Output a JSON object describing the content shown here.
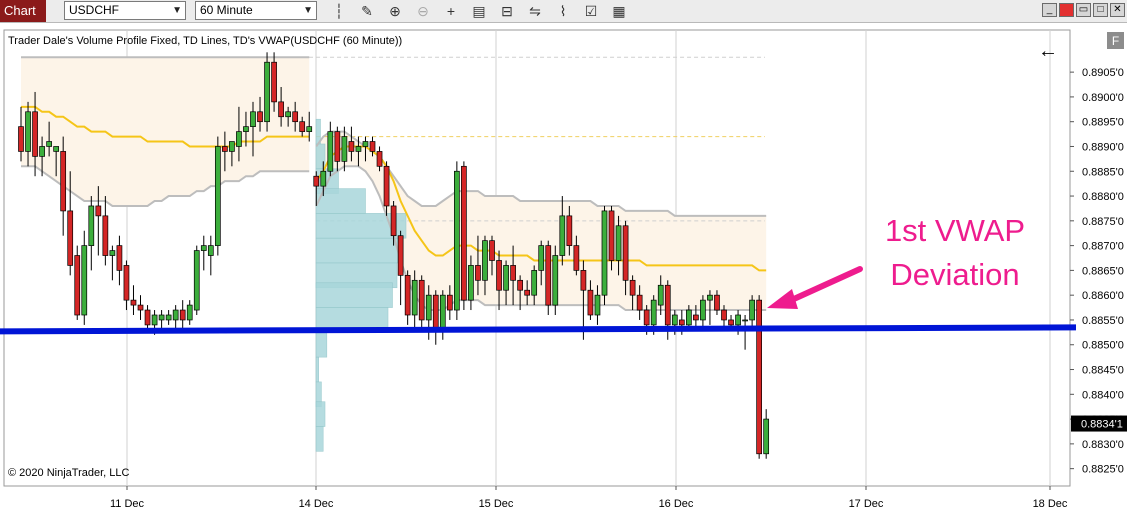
{
  "toolbar": {
    "tab_label": "Chart",
    "instrument": "USDCHF",
    "timeframe": "60 Minute",
    "icons": [
      "bar-style-icon",
      "draw-pencil-icon",
      "zoom-in-icon",
      "zoom-out-icon",
      "crosshair-icon",
      "data-box-icon",
      "indicators-icon",
      "strategies-icon",
      "properties-icon"
    ],
    "window_buttons": [
      "minimize",
      "restore",
      "maximize",
      "close"
    ]
  },
  "chart": {
    "title_text": "Trader Dale's Volume Profile Fixed, TD Lines, TD's VWAP(USDCHF (60 Minute))",
    "copyright": "© 2020 NinjaTrader, LLC",
    "panel_letter": "F",
    "back_arrow_glyph": "←",
    "last_price_label": "0.8834'1",
    "annotation_line1": "1st VWAP",
    "annotation_line2": "Deviation",
    "colors": {
      "up": "#3cae3c",
      "down": "#d42626",
      "vwap": "#f5c518",
      "band": "#bdbdbd",
      "support": "#0015d6",
      "profile": "#a9d7db",
      "arrow": "#ee1c8e"
    }
  },
  "chart_data": {
    "type": "candlestick",
    "x_axis_labels": [
      "11 Dec",
      "14 Dec",
      "15 Dec",
      "16 Dec",
      "17 Dec",
      "18 Dec"
    ],
    "y_axis_labels": [
      "0.8905'0",
      "0.8900'0",
      "0.8895'0",
      "0.8890'0",
      "0.8885'0",
      "0.8880'0",
      "0.8875'0",
      "0.8870'0",
      "0.8865'0",
      "0.8860'0",
      "0.8855'0",
      "0.8850'0",
      "0.8845'0",
      "0.8840'0",
      "0.8835'0",
      "0.8830'0",
      "0.8825'0"
    ],
    "y_ticks": [
      0.8905,
      0.89,
      0.8895,
      0.889,
      0.8885,
      0.888,
      0.8875,
      0.887,
      0.8865,
      0.886,
      0.8855,
      0.885,
      0.8845,
      0.884,
      0.8835,
      0.883,
      0.8825
    ],
    "ylim": [
      0.88215,
      0.89135
    ],
    "last_price": 0.88341,
    "support_level": 0.88531,
    "candles": [
      [
        0.8894,
        0.8898,
        0.8887,
        0.8889
      ],
      [
        0.8889,
        0.8899,
        0.8886,
        0.8897
      ],
      [
        0.8897,
        0.8901,
        0.8884,
        0.8888
      ],
      [
        0.8888,
        0.8892,
        0.8884,
        0.889
      ],
      [
        0.889,
        0.8895,
        0.8888,
        0.8891
      ],
      [
        0.8889,
        0.889,
        0.8884,
        0.889
      ],
      [
        0.8889,
        0.8892,
        0.8872,
        0.8877
      ],
      [
        0.8877,
        0.8885,
        0.8864,
        0.8866
      ],
      [
        0.8868,
        0.887,
        0.8855,
        0.8856
      ],
      [
        0.8856,
        0.8873,
        0.8854,
        0.887
      ],
      [
        0.887,
        0.888,
        0.8865,
        0.8878
      ],
      [
        0.8878,
        0.8882,
        0.8868,
        0.8876
      ],
      [
        0.8876,
        0.888,
        0.8866,
        0.8868
      ],
      [
        0.8868,
        0.887,
        0.8863,
        0.8869
      ],
      [
        0.887,
        0.8872,
        0.8862,
        0.8865
      ],
      [
        0.8866,
        0.8867,
        0.8857,
        0.8859
      ],
      [
        0.8859,
        0.8862,
        0.8856,
        0.8858
      ],
      [
        0.8858,
        0.886,
        0.8855,
        0.8857
      ],
      [
        0.8857,
        0.8858,
        0.8853,
        0.8854
      ],
      [
        0.8854,
        0.8857,
        0.8852,
        0.8856
      ],
      [
        0.8855,
        0.8857,
        0.8853,
        0.8856
      ],
      [
        0.8855,
        0.8857,
        0.8854,
        0.8856
      ],
      [
        0.8855,
        0.8858,
        0.8853,
        0.8857
      ],
      [
        0.8857,
        0.8859,
        0.8853,
        0.8855
      ],
      [
        0.8855,
        0.8859,
        0.8854,
        0.8858
      ],
      [
        0.8857,
        0.887,
        0.8856,
        0.8869
      ],
      [
        0.8869,
        0.8872,
        0.8865,
        0.887
      ],
      [
        0.8868,
        0.8872,
        0.8864,
        0.887
      ],
      [
        0.887,
        0.8892,
        0.8868,
        0.889
      ],
      [
        0.889,
        0.8893,
        0.8885,
        0.8889
      ],
      [
        0.8889,
        0.8891,
        0.8886,
        0.8891
      ],
      [
        0.889,
        0.8898,
        0.8887,
        0.8893
      ],
      [
        0.8893,
        0.8897,
        0.889,
        0.8894
      ],
      [
        0.8894,
        0.8899,
        0.8888,
        0.8897
      ],
      [
        0.8897,
        0.89,
        0.8893,
        0.8895
      ],
      [
        0.8895,
        0.8909,
        0.8893,
        0.8907
      ],
      [
        0.8907,
        0.8909,
        0.8897,
        0.8899
      ],
      [
        0.8899,
        0.8902,
        0.8894,
        0.8896
      ],
      [
        0.8896,
        0.8898,
        0.8894,
        0.8897
      ],
      [
        0.8897,
        0.8899,
        0.8893,
        0.8895
      ],
      [
        0.8895,
        0.8896,
        0.8892,
        0.8893
      ],
      [
        0.8893,
        0.8897,
        0.8891,
        0.8894
      ],
      [
        0.8884,
        0.8885,
        0.8878,
        0.8882
      ],
      [
        0.8882,
        0.8887,
        0.888,
        0.8885
      ],
      [
        0.8885,
        0.8895,
        0.8884,
        0.8893
      ],
      [
        0.8893,
        0.8894,
        0.8885,
        0.8887
      ],
      [
        0.8887,
        0.8894,
        0.8885,
        0.8892
      ],
      [
        0.8891,
        0.8894,
        0.8887,
        0.8889
      ],
      [
        0.8889,
        0.8892,
        0.8886,
        0.889
      ],
      [
        0.889,
        0.8892,
        0.8887,
        0.8891
      ],
      [
        0.8891,
        0.8892,
        0.8888,
        0.8889
      ],
      [
        0.8889,
        0.889,
        0.8885,
        0.8886
      ],
      [
        0.8886,
        0.8887,
        0.8876,
        0.8878
      ],
      [
        0.8878,
        0.8879,
        0.887,
        0.8872
      ],
      [
        0.8872,
        0.8873,
        0.8858,
        0.8864
      ],
      [
        0.8864,
        0.8865,
        0.8854,
        0.8856
      ],
      [
        0.8856,
        0.8865,
        0.8853,
        0.8863
      ],
      [
        0.8863,
        0.8864,
        0.8853,
        0.8855
      ],
      [
        0.8855,
        0.8862,
        0.8851,
        0.886
      ],
      [
        0.886,
        0.8861,
        0.885,
        0.8853
      ],
      [
        0.8853,
        0.8861,
        0.8851,
        0.886
      ],
      [
        0.886,
        0.8862,
        0.8855,
        0.8857
      ],
      [
        0.8857,
        0.8887,
        0.8855,
        0.8885
      ],
      [
        0.8886,
        0.8887,
        0.8857,
        0.8859
      ],
      [
        0.8859,
        0.8868,
        0.8857,
        0.8866
      ],
      [
        0.8866,
        0.8872,
        0.886,
        0.8863
      ],
      [
        0.8863,
        0.8872,
        0.886,
        0.8871
      ],
      [
        0.8871,
        0.8872,
        0.8864,
        0.8867
      ],
      [
        0.8867,
        0.8869,
        0.8857,
        0.8861
      ],
      [
        0.8861,
        0.8867,
        0.8858,
        0.8866
      ],
      [
        0.8866,
        0.887,
        0.8858,
        0.8863
      ],
      [
        0.8863,
        0.8864,
        0.8857,
        0.8861
      ],
      [
        0.8861,
        0.8863,
        0.8858,
        0.886
      ],
      [
        0.886,
        0.8866,
        0.8858,
        0.8865
      ],
      [
        0.8865,
        0.8871,
        0.8862,
        0.887
      ],
      [
        0.887,
        0.8871,
        0.8856,
        0.8858
      ],
      [
        0.8858,
        0.887,
        0.8856,
        0.8868
      ],
      [
        0.8868,
        0.888,
        0.8866,
        0.8876
      ],
      [
        0.8876,
        0.8878,
        0.8868,
        0.887
      ],
      [
        0.887,
        0.8872,
        0.8864,
        0.8865
      ],
      [
        0.8865,
        0.8867,
        0.8851,
        0.8861
      ],
      [
        0.8861,
        0.8863,
        0.8855,
        0.8856
      ],
      [
        0.8856,
        0.8862,
        0.8854,
        0.886
      ],
      [
        0.886,
        0.8878,
        0.8858,
        0.8877
      ],
      [
        0.8877,
        0.8878,
        0.8865,
        0.8867
      ],
      [
        0.8867,
        0.8876,
        0.8864,
        0.8874
      ],
      [
        0.8874,
        0.8875,
        0.886,
        0.8863
      ],
      [
        0.8863,
        0.8864,
        0.8857,
        0.886
      ],
      [
        0.886,
        0.8862,
        0.8855,
        0.8857
      ],
      [
        0.8857,
        0.8858,
        0.8852,
        0.8854
      ],
      [
        0.8854,
        0.886,
        0.8852,
        0.8859
      ],
      [
        0.8858,
        0.8864,
        0.8856,
        0.8862
      ],
      [
        0.8862,
        0.8863,
        0.8851,
        0.8854
      ],
      [
        0.8854,
        0.8857,
        0.8852,
        0.8856
      ],
      [
        0.8855,
        0.8857,
        0.8852,
        0.8854
      ],
      [
        0.8854,
        0.8858,
        0.8853,
        0.8857
      ],
      [
        0.8856,
        0.8858,
        0.8853,
        0.8855
      ],
      [
        0.8855,
        0.886,
        0.8853,
        0.8859
      ],
      [
        0.8859,
        0.8861,
        0.8854,
        0.886
      ],
      [
        0.886,
        0.8861,
        0.8856,
        0.8857
      ],
      [
        0.8857,
        0.8858,
        0.8853,
        0.8855
      ],
      [
        0.8855,
        0.8856,
        0.8853,
        0.8854
      ],
      [
        0.8854,
        0.8857,
        0.8852,
        0.8856
      ],
      [
        0.8855,
        0.8856,
        0.8849,
        0.8855
      ],
      [
        0.8855,
        0.886,
        0.8853,
        0.8859
      ],
      [
        0.8859,
        0.886,
        0.8827,
        0.8828
      ],
      [
        0.8828,
        0.8837,
        0.8827,
        0.8835
      ]
    ],
    "vwap": [
      0.8898,
      0.8898,
      0.8898,
      0.8897,
      0.8897,
      0.8896,
      0.8896,
      0.8895,
      0.8894,
      0.8894,
      0.8893,
      0.8893,
      0.8893,
      0.8892,
      0.8892,
      0.8892,
      0.8892,
      0.8892,
      0.8891,
      0.8891,
      0.8891,
      0.8891,
      0.8891,
      0.8891,
      0.889,
      0.889,
      0.889,
      0.889,
      0.889,
      0.889,
      0.889,
      0.8891,
      0.8891,
      0.8891,
      0.8891,
      0.8892,
      0.8892,
      0.8892,
      0.8892,
      0.8892,
      0.8892,
      0.8892,
      0.8883,
      0.8885,
      0.8888,
      0.8889,
      0.889,
      0.889,
      0.889,
      0.889,
      0.8889,
      0.8888,
      0.8886,
      0.8883,
      0.8879,
      0.8876,
      0.8873,
      0.8871,
      0.8869,
      0.8868,
      0.8868,
      0.8869,
      0.887,
      0.887,
      0.887,
      0.8869,
      0.8869,
      0.8869,
      0.8868,
      0.8868,
      0.8868,
      0.8868,
      0.8868,
      0.8867,
      0.8867,
      0.8867,
      0.8867,
      0.8867,
      0.8867,
      0.8867,
      0.8867,
      0.8867,
      0.8867,
      0.8867,
      0.8867,
      0.8867,
      0.8867,
      0.8867,
      0.8867,
      0.8866,
      0.8866,
      0.8866,
      0.8866,
      0.8866,
      0.8866,
      0.8866,
      0.8866,
      0.8866,
      0.8866,
      0.8866,
      0.8866,
      0.8866,
      0.8866,
      0.8866,
      0.8866,
      0.8865,
      0.8865
    ],
    "upper_band": [
      0.8908,
      0.8908,
      0.8908,
      0.8908,
      0.8908,
      0.8908,
      0.8908,
      0.8908,
      0.8908,
      0.8908,
      0.8908,
      0.8908,
      0.8908,
      0.8908,
      0.8908,
      0.8908,
      0.8908,
      0.8908,
      0.8908,
      0.8908,
      0.8908,
      0.8908,
      0.8908,
      0.8908,
      0.8908,
      0.8908,
      0.8908,
      0.8908,
      0.8908,
      0.8908,
      0.8908,
      0.8908,
      0.8908,
      0.8908,
      0.8908,
      0.8908,
      0.8908,
      0.8908,
      0.8908,
      0.8908,
      0.8908,
      0.8908,
      0.889,
      0.8892,
      0.8893,
      0.8893,
      0.8893,
      0.8892,
      0.8891,
      0.889,
      0.8889,
      0.8888,
      0.8886,
      0.8884,
      0.8882,
      0.888,
      0.8879,
      0.8878,
      0.8878,
      0.8878,
      0.8879,
      0.888,
      0.8881,
      0.8881,
      0.8881,
      0.8881,
      0.888,
      0.888,
      0.888,
      0.888,
      0.888,
      0.8879,
      0.8879,
      0.8879,
      0.8879,
      0.8879,
      0.8879,
      0.8879,
      0.8879,
      0.8879,
      0.8879,
      0.8879,
      0.8878,
      0.8878,
      0.8878,
      0.8878,
      0.8877,
      0.8877,
      0.8877,
      0.8877,
      0.8877,
      0.8877,
      0.8877,
      0.8876,
      0.8876,
      0.8876,
      0.8876,
      0.8876,
      0.8876,
      0.8876,
      0.8876,
      0.8876,
      0.8876,
      0.8876,
      0.8876,
      0.8876,
      0.8876
    ],
    "lower_band": [
      0.8886,
      0.8886,
      0.8886,
      0.8885,
      0.8884,
      0.8883,
      0.8882,
      0.8881,
      0.888,
      0.8879,
      0.8879,
      0.8879,
      0.8879,
      0.8878,
      0.8878,
      0.8878,
      0.8878,
      0.8878,
      0.8878,
      0.8879,
      0.8879,
      0.888,
      0.888,
      0.888,
      0.888,
      0.8881,
      0.8881,
      0.8882,
      0.8882,
      0.8883,
      0.8883,
      0.8883,
      0.8884,
      0.8884,
      0.8885,
      0.8885,
      0.8885,
      0.8885,
      0.8885,
      0.8885,
      0.8885,
      0.8885,
      0.8878,
      0.8881,
      0.8884,
      0.8885,
      0.8886,
      0.8886,
      0.8886,
      0.8885,
      0.8883,
      0.888,
      0.8876,
      0.8872,
      0.8867,
      0.8863,
      0.886,
      0.8858,
      0.8857,
      0.8857,
      0.8857,
      0.8858,
      0.8859,
      0.8859,
      0.8859,
      0.8859,
      0.8858,
      0.8858,
      0.8858,
      0.8858,
      0.8858,
      0.8858,
      0.8858,
      0.8858,
      0.8858,
      0.8858,
      0.8858,
      0.8858,
      0.8858,
      0.8858,
      0.8858,
      0.8858,
      0.8858,
      0.8858,
      0.8858,
      0.8858,
      0.8857,
      0.8857,
      0.8857,
      0.8857,
      0.8857,
      0.8857,
      0.8857,
      0.8857,
      0.8857,
      0.8857,
      0.8857,
      0.8857,
      0.8857,
      0.8857,
      0.8857,
      0.8857,
      0.8857,
      0.8857,
      0.8857,
      0.8857,
      0.8857
    ],
    "volume_profile": {
      "levels": [
        0.8893,
        0.8888,
        0.8883,
        0.8879,
        0.8874,
        0.8869,
        0.8864,
        0.886,
        0.8855,
        0.885,
        0.8845,
        0.884,
        0.8836,
        0.8831
      ],
      "relative_volume": [
        0.05,
        0.1,
        0.25,
        0.55,
        1.0,
        0.95,
        0.9,
        0.85,
        0.8,
        0.12,
        0.03,
        0.06,
        0.1,
        0.08
      ]
    },
    "dashed_levels": [
      0.8908,
      0.8892,
      0.8875
    ],
    "day_separators": [
      "11 Dec",
      "14 Dec",
      "15 Dec",
      "16 Dec",
      "17 Dec",
      "18 Dec"
    ]
  }
}
